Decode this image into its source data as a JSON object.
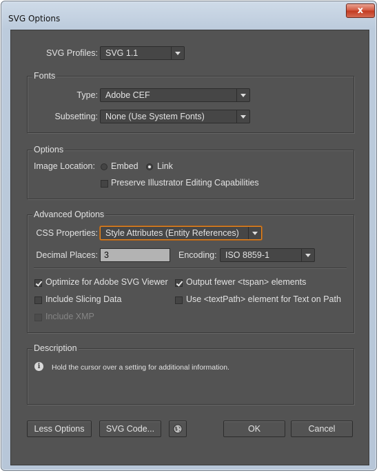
{
  "window": {
    "title": "SVG Options",
    "close_glyph": "x"
  },
  "profiles": {
    "label": "SVG Profiles:",
    "value": "SVG 1.1"
  },
  "fonts": {
    "legend": "Fonts",
    "type_label": "Type:",
    "type_value": "Adobe CEF",
    "subsetting_label": "Subsetting:",
    "subsetting_value": "None (Use System Fonts)"
  },
  "options": {
    "legend": "Options",
    "image_location_label": "Image Location:",
    "embed_label": "Embed",
    "embed_selected": false,
    "link_label": "Link",
    "link_selected": true,
    "preserve_label": "Preserve Illustrator Editing Capabilities",
    "preserve_checked": false
  },
  "advanced": {
    "legend": "Advanced Options",
    "css_label": "CSS Properties:",
    "css_value": "Style Attributes (Entity References)",
    "decimal_label": "Decimal Places:",
    "decimal_value": "3",
    "encoding_label": "Encoding:",
    "encoding_value": "ISO 8859-1",
    "optimize_label": "Optimize for Adobe SVG Viewer",
    "optimize_checked": true,
    "output_fewer_label": "Output fewer <tspan> elements",
    "output_fewer_checked": true,
    "slicing_label": "Include Slicing Data",
    "slicing_checked": false,
    "textpath_label": "Use <textPath> element for Text on Path",
    "textpath_checked": false,
    "xmp_label": "Include XMP",
    "xmp_checked": false,
    "xmp_disabled": true
  },
  "description": {
    "legend": "Description",
    "text": "Hold the cursor over a setting for additional information.",
    "icon": "info-icon"
  },
  "buttons": {
    "less_options": "Less Options",
    "svg_code": "SVG Code...",
    "web_icon": "globe-icon",
    "ok": "OK",
    "cancel": "Cancel"
  },
  "colors": {
    "panel": "#535353",
    "focus_accent": "#e8861e"
  }
}
